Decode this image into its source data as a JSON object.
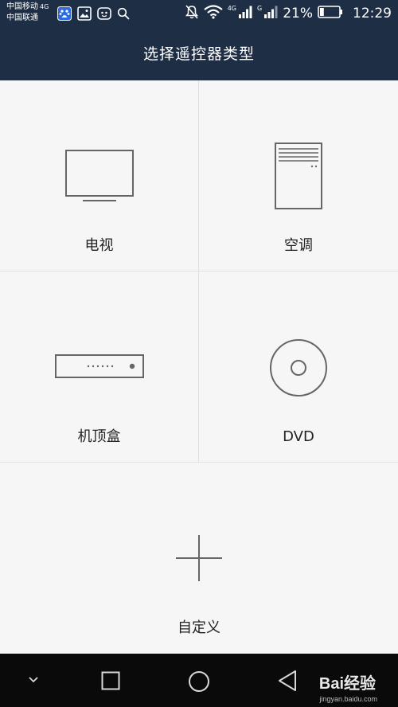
{
  "status_bar": {
    "carrier_1": "中国移动",
    "carrier_1_network": "4G",
    "carrier_2": "中国联通",
    "left_icons": [
      "baidu-app-icon",
      "gallery-icon",
      "bot-app-icon",
      "search-icon"
    ],
    "right_icons": [
      "mute-icon",
      "wifi-icon",
      "signal-icon",
      "signal-icon"
    ],
    "signal_1_network": "4G",
    "signal_2_network": "G",
    "battery_percent": "21%",
    "battery_level": 0.21,
    "time": "12:29"
  },
  "header": {
    "title": "选择遥控器类型",
    "background_color": "#1e2e45"
  },
  "remote_types": [
    {
      "label": "电视",
      "icon": "tv-icon"
    },
    {
      "label": "空调",
      "icon": "air-conditioner-icon"
    },
    {
      "label": "机顶盒",
      "icon": "set-top-box-icon"
    },
    {
      "label": "DVD",
      "icon": "dvd-disc-icon"
    },
    {
      "label": "自定义",
      "icon": "plus-icon"
    }
  ],
  "nav_bar": {
    "buttons": [
      "hide-nav-chevron-icon",
      "recent-apps-icon",
      "home-icon",
      "back-icon"
    ]
  },
  "watermark": {
    "brand": "Bai经验",
    "domain": "jingyan.baidu.com"
  }
}
